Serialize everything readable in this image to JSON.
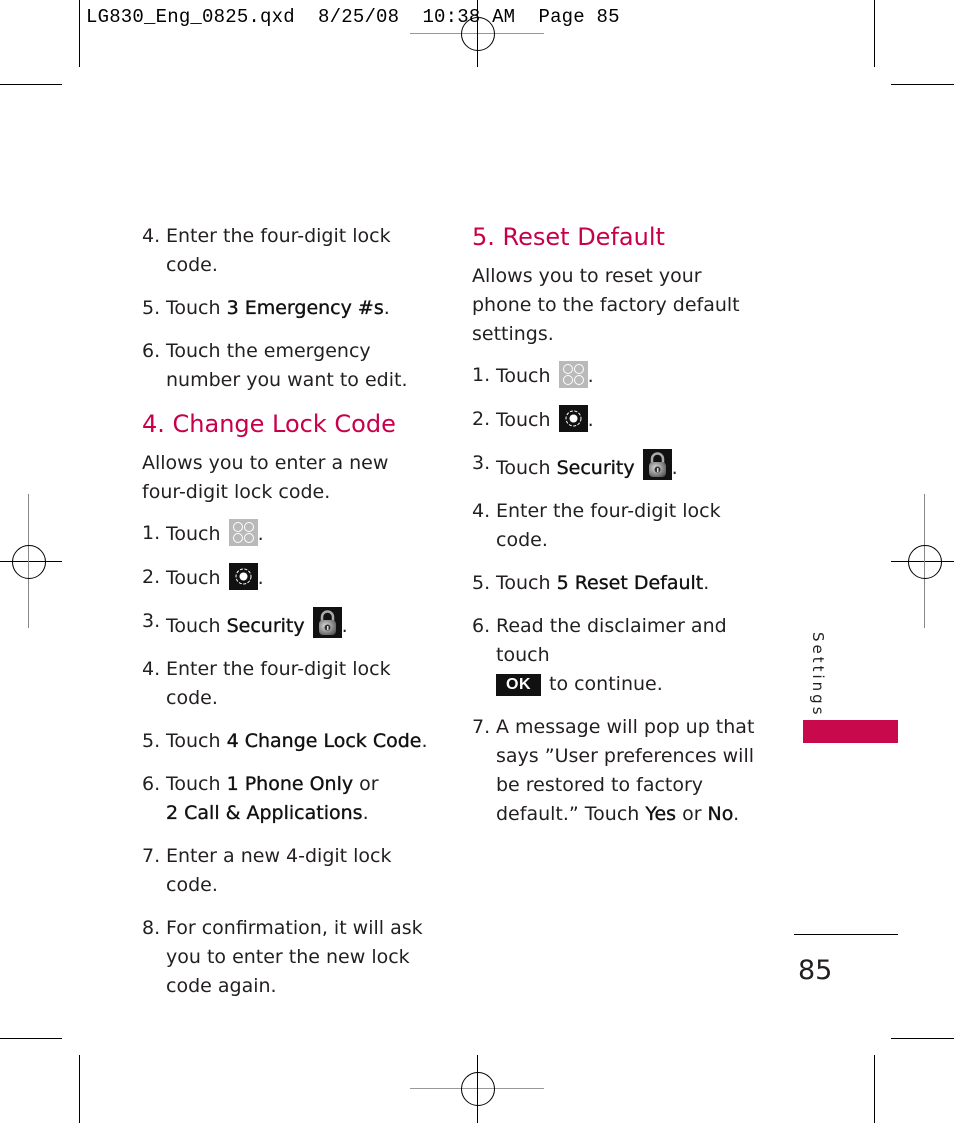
{
  "slug": "LG830_Eng_0825.qxd  8/25/08  10:38 AM  Page 85",
  "left_column": {
    "continued_steps": [
      {
        "num": "4.",
        "parts": [
          {
            "t": "Enter the four-digit lock code."
          }
        ]
      },
      {
        "num": "5.",
        "parts": [
          {
            "t": "Touch "
          },
          {
            "t": "3 Emergency #s",
            "bold": true
          },
          {
            "t": "."
          }
        ]
      },
      {
        "num": "6.",
        "parts": [
          {
            "t": "Touch the emergency number you want to edit."
          }
        ]
      }
    ],
    "section": {
      "heading": "4. Change Lock Code",
      "description": "Allows you to enter a new four-digit lock code.",
      "steps": [
        {
          "num": "1.",
          "parts": [
            {
              "t": "Touch "
            }
          ],
          "icon": "apps-grid-icon"
        },
        {
          "num": "2.",
          "parts": [
            {
              "t": "Touch "
            }
          ],
          "icon": "settings-gear-icon"
        },
        {
          "num": "3.",
          "parts": [
            {
              "t": "Touch "
            },
            {
              "t": "Security",
              "bold": true
            },
            {
              "t": " "
            }
          ],
          "icon": "padlock-icon"
        },
        {
          "num": "4.",
          "parts": [
            {
              "t": "Enter the four-digit lock code."
            }
          ]
        },
        {
          "num": "5.",
          "parts": [
            {
              "t": "Touch "
            },
            {
              "t": "4 Change Lock Code",
              "bold": true
            },
            {
              "t": "."
            }
          ]
        },
        {
          "num": "6.",
          "parts": [
            {
              "t": "Touch "
            },
            {
              "t": "1 Phone Only",
              "bold": true
            },
            {
              "t": " or "
            },
            {
              "br": true
            },
            {
              "t": "2 Call & Applications",
              "bold": true
            },
            {
              "t": "."
            }
          ]
        },
        {
          "num": "7.",
          "parts": [
            {
              "t": "Enter a new 4-digit lock code."
            }
          ]
        },
        {
          "num": "8.",
          "parts": [
            {
              "t": "For confirmation, it will ask you to enter the new lock code again."
            }
          ]
        }
      ]
    }
  },
  "right_column": {
    "section": {
      "heading": "5. Reset Default",
      "description": "Allows you to reset your phone to the factory default settings.",
      "steps": [
        {
          "num": "1.",
          "parts": [
            {
              "t": "Touch "
            }
          ],
          "icon": "apps-grid-icon"
        },
        {
          "num": "2.",
          "parts": [
            {
              "t": "Touch "
            }
          ],
          "icon": "settings-gear-icon"
        },
        {
          "num": "3.",
          "parts": [
            {
              "t": "Touch "
            },
            {
              "t": "Security",
              "bold": true
            },
            {
              "t": " "
            }
          ],
          "icon": "padlock-icon"
        },
        {
          "num": "4.",
          "parts": [
            {
              "t": "Enter the four-digit lock code."
            }
          ]
        },
        {
          "num": "5.",
          "parts": [
            {
              "t": "Touch "
            },
            {
              "t": "5 Reset Default",
              "bold": true
            },
            {
              "t": "."
            }
          ]
        },
        {
          "num": "6.",
          "parts": [
            {
              "t": "Read the disclaimer and touch "
            },
            {
              "br": true
            },
            {
              "ok": "OK"
            },
            {
              "t": "to continue."
            }
          ]
        },
        {
          "num": "7.",
          "parts": [
            {
              "t": "A message will pop up that says ”User preferences will be restored to factory default.” Touch "
            },
            {
              "t": "Yes",
              "bold": true
            },
            {
              "t": " or "
            },
            {
              "t": "No",
              "bold": true
            },
            {
              "t": "."
            }
          ]
        }
      ]
    }
  },
  "side_tab": {
    "label": "Settings",
    "color": "#c8094b"
  },
  "page_number": "85",
  "colors": {
    "heading": "#c8004a",
    "text": "#231f20"
  }
}
